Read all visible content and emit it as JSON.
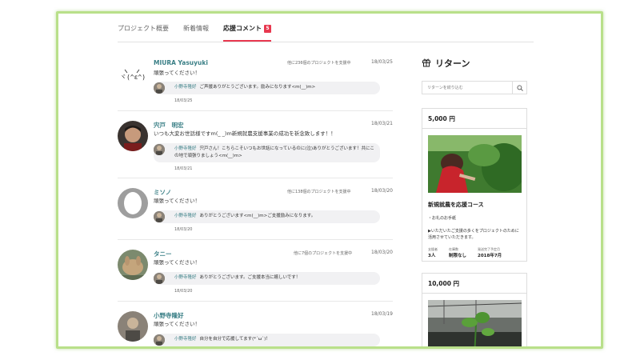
{
  "tabs": [
    {
      "label": "プロジェクト概要"
    },
    {
      "label": "新着情報"
    },
    {
      "label": "応援コメント",
      "badge": "5",
      "active": true
    }
  ],
  "comments": [
    {
      "name": "MIURA Yasuyuki",
      "support": "他に236個のプロジェクトを支援中",
      "date": "18/03/25",
      "body": "頑張ってください！",
      "reply_name": "小野寺隆好",
      "reply_text": "ご声援ありがとうございます。励みになります<m(__)m>",
      "reply_date": "18/03/25"
    },
    {
      "name": "宍戸　明宏",
      "support": "",
      "date": "18/03/21",
      "body": "いつも大変お世話様ですm(_ _)m新規就農支援事業の成功を祈念致します！！",
      "reply_name": "小野寺隆好",
      "reply_text": "宍戸さん！こちらこそいつもお世話になっているのに(泣)ありがとうございます！共にこの地で頑張りましょう<m(__)m>",
      "reply_date": "18/03/21"
    },
    {
      "name": "ミソノ",
      "support": "他に138個のプロジェクトを支援中",
      "date": "18/03/20",
      "body": "頑張ってください！",
      "reply_name": "小野寺隆好",
      "reply_text": "ありがとうございます<m(__)m>ご支援励みになります。",
      "reply_date": "18/03/20"
    },
    {
      "name": "タニー",
      "support": "他に7個のプロジェクトを支援中",
      "date": "18/03/20",
      "body": "頑張ってください！",
      "reply_name": "小野寺隆好",
      "reply_text": "ありがとうございます。ご支援本当に嬉しいです！",
      "reply_date": "18/03/20"
    },
    {
      "name": "小野寺隆好",
      "support": "",
      "date": "18/03/19",
      "body": "頑張ってください！",
      "reply_name": "小野寺隆好",
      "reply_text": "自分を自分で応援してます(*´ω`)！",
      "reply_date": ""
    }
  ],
  "sidebar": {
    "title": "リターン",
    "search_placeholder": "リターンを絞り込む",
    "cards": [
      {
        "price": "5,000 円",
        "course": "新規就農を応援コース",
        "item1": "・お礼のお手紙",
        "item2": "▶いただいたご支援の多くをプロジェクトのために活用させていただきます。",
        "stat_labels": [
          "支援者",
          "在庫数",
          "発送完了予定月"
        ],
        "stat_values": [
          "3人",
          "制限なし",
          "2018年7月"
        ]
      },
      {
        "price": "10,000 円"
      }
    ]
  },
  "colors": {
    "accent": "#e8384f",
    "name": "#3a7f86",
    "frame": "#b9e08a"
  }
}
